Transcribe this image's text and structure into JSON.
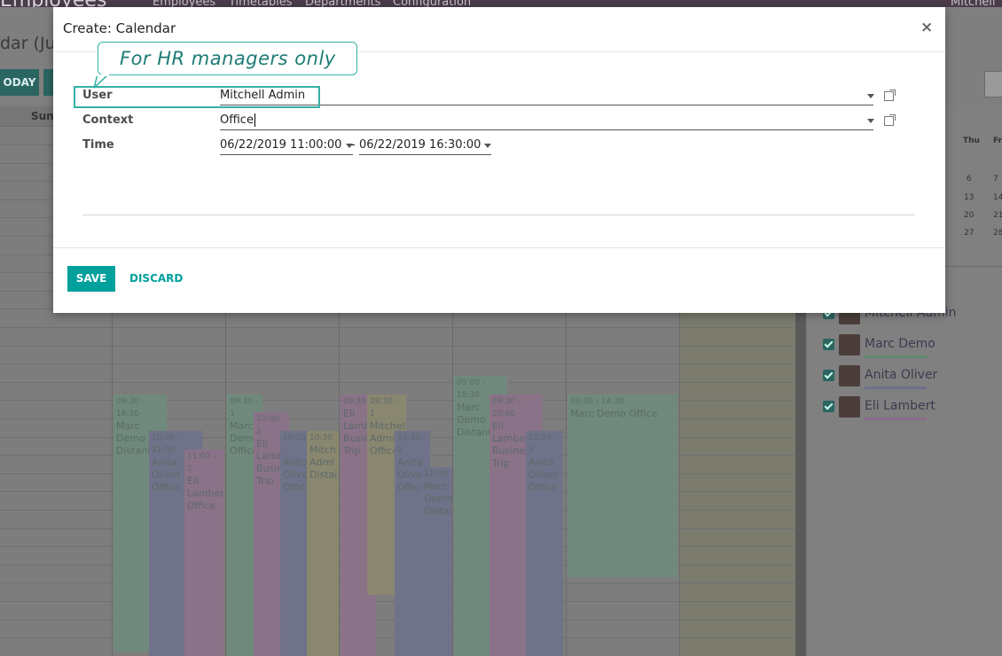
{
  "background": {
    "app_name": "Employees",
    "menu": [
      "Employees",
      "Timetables",
      "Departments",
      "Configuration"
    ],
    "user": "Mitchell A",
    "page_title": "dar (Jun",
    "today_label": "ODAY",
    "day_header": "Sun",
    "mini_calendar": {
      "headers": [
        "Thu",
        "Fr"
      ],
      "rows": [
        [
          "6",
          "7"
        ],
        [
          "13",
          "14"
        ],
        [
          "20",
          "21"
        ],
        [
          "27",
          "28"
        ]
      ]
    },
    "attendees": [
      {
        "name": "Mitchell Admin",
        "color": "#9ab27a"
      },
      {
        "name": "Marc Demo",
        "color": "#7fbf9a"
      },
      {
        "name": "Anita Oliver",
        "color": "#9a9ac8"
      },
      {
        "name": "Eli Lambert",
        "color": "#c78ac8"
      }
    ],
    "events": [
      {
        "id": "e1",
        "time": "09:30 - 16:30",
        "text": "Marc Demo Distant",
        "color": "green"
      },
      {
        "id": "e2",
        "time": "10:30 - 21:00",
        "text": "Anita Oliver Office",
        "color": "blue"
      },
      {
        "id": "e3",
        "time": "11:00 - 1",
        "text": "Eli Lamber Office",
        "color": "pink"
      },
      {
        "id": "e4",
        "time": "09:30 - 1",
        "text": "Marc Demo Office",
        "color": "green"
      },
      {
        "id": "e5",
        "time": "10:00 - 2",
        "text": "Eli Lamb Busin Trip",
        "color": "pink"
      },
      {
        "id": "e6",
        "time": "10:30 -",
        "text": "Anita Oliver Office",
        "color": "blue"
      },
      {
        "id": "e7",
        "time": "10:30",
        "text": "Mitch Admi Distai",
        "color": "yellow"
      },
      {
        "id": "e8",
        "time": "09:30 -",
        "text": "Eli Lamb Busin Trip",
        "color": "pink"
      },
      {
        "id": "e9",
        "time": "09:30 - 1",
        "text": "Mitchel Admin Office",
        "color": "yellow"
      },
      {
        "id": "e10",
        "time": "10:30 - 2",
        "text": "Anita Oliver Office",
        "color": "blue"
      },
      {
        "id": "e11",
        "time": "11:30",
        "text": "Marc Demo Distai",
        "color": "blue"
      },
      {
        "id": "e12",
        "time": "09:00 - 18:30",
        "text": "Marc Demo Distant",
        "color": "green"
      },
      {
        "id": "e13",
        "time": "09:30 - 20:00",
        "text": "Eli Lambert Business Trip",
        "color": "pink"
      },
      {
        "id": "e14",
        "time": "10:30 - 2",
        "text": "Anita Oliver Office",
        "color": "blue"
      },
      {
        "id": "e15",
        "time": "09:30 - 14:30",
        "text": "Marc Demo Office",
        "color": "green"
      }
    ]
  },
  "modal": {
    "title": "Create: Calendar",
    "close_symbol": "×",
    "fields": {
      "user_label": "User",
      "user_value": "Mitchell Admin",
      "context_label": "Context",
      "context_value": "Office",
      "time_label": "Time",
      "time_start": "06/22/2019 11:00:00",
      "time_separator": "-",
      "time_end": "06/22/2019 16:30:00"
    },
    "save_label": "SAVE",
    "discard_label": "DISCARD"
  },
  "tooltip": {
    "text": "For HR managers only",
    "accent": "#35b1a5"
  },
  "colors": {
    "primary": "#00a09d",
    "topbar": "#4a3c4a"
  }
}
